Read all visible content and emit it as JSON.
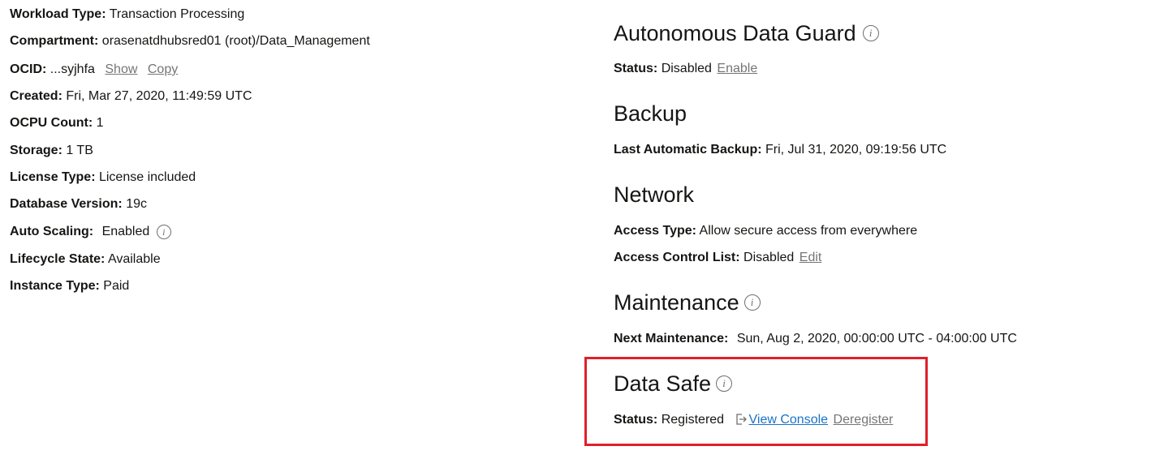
{
  "details": [
    {
      "label": "Workload Type:",
      "value": "Transaction Processing"
    },
    {
      "label": "Compartment:",
      "value": "orasenatdhubsred01 (root)/Data_Management"
    },
    {
      "label": "OCID:",
      "value": "...syjhfa",
      "show": "Show",
      "copy": "Copy"
    },
    {
      "label": "Created:",
      "value": "Fri, Mar 27, 2020, 11:49:59 UTC"
    },
    {
      "label": "OCPU Count:",
      "value": "1"
    },
    {
      "label": "Storage:",
      "value": "1 TB"
    },
    {
      "label": "License Type:",
      "value": "License included"
    },
    {
      "label": "Database Version:",
      "value": "19c"
    },
    {
      "label": "Auto Scaling:",
      "value": "Enabled"
    },
    {
      "label": "Lifecycle State:",
      "value": "Available"
    },
    {
      "label": "Instance Type:",
      "value": "Paid"
    }
  ],
  "data_guard": {
    "title": "Autonomous Data Guard",
    "status_label": "Status:",
    "status_value": "Disabled",
    "enable_link": "Enable"
  },
  "backup": {
    "title": "Backup",
    "label": "Last Automatic Backup:",
    "value": "Fri, Jul 31, 2020, 09:19:56 UTC"
  },
  "network": {
    "title": "Network",
    "access_type_label": "Access Type:",
    "access_type_value": "Allow secure access from everywhere",
    "acl_label": "Access Control List:",
    "acl_value": "Disabled",
    "edit_link": "Edit"
  },
  "maintenance": {
    "title": "Maintenance",
    "label": "Next Maintenance:",
    "value": "Sun, Aug 2, 2020, 00:00:00 UTC - 04:00:00 UTC"
  },
  "data_safe": {
    "title": "Data Safe",
    "status_label": "Status:",
    "status_value": "Registered",
    "view_console": "View Console",
    "deregister": "Deregister"
  },
  "info_glyph": "i",
  "colors": {
    "highlight": "#e0202a",
    "link": "#1a73c7",
    "muted_link": "#757575"
  }
}
